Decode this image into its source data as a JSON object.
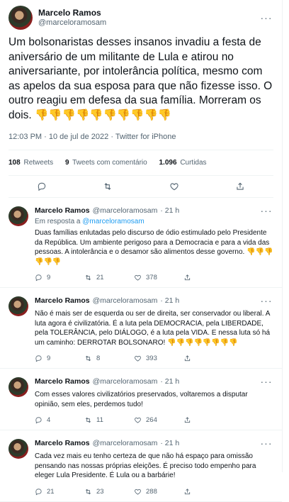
{
  "main": {
    "name": "Marcelo Ramos",
    "handle": "@marceloramosam",
    "text": "Um bolsonaristas desses insanos invadiu a festa de aniversário de um militante de Lula e atirou no aniversariante, por intolerância política, mesmo com as apelos da sua esposa para que não fizesse isso. O outro reagiu em defesa da sua família. Morreram os dois.",
    "emojis": "👎👎👎👎👎👎👎👎👎👎",
    "time": "12:03 PM",
    "date": "10 de jul de 2022",
    "source": "Twitter for iPhone",
    "stats": [
      {
        "count": "108",
        "label": "Retweets"
      },
      {
        "count": "9",
        "label": "Tweets com comentário"
      },
      {
        "count": "1.096",
        "label": "Curtidas"
      }
    ]
  },
  "replies": [
    {
      "name": "Marcelo Ramos",
      "handle": "@marceloramosam",
      "age": "· 21 h",
      "in_reply_prefix": "Em resposta a",
      "in_reply_handle": "@marceloramosam",
      "text": "Duas famílias enlutadas pelo discurso de ódio estimulado pelo Presidente da República. Um ambiente perigoso para a Democracia e para a vida das pessoas. A intolerância e o desamor são alimentos desse governo.",
      "emojis": "👎👎👎👎👎👎",
      "replies": "9",
      "retweets": "21",
      "likes": "378"
    },
    {
      "name": "Marcelo Ramos",
      "handle": "@marceloramosam",
      "age": "· 21 h",
      "text": "Não é mais ser de esquerda ou ser de direita, ser conservador ou liberal. A luta agora é civilizatória. É a luta pela DEMOCRACIA, pela LIBERDADE, pela TOLERÂNCIA, pelo DIÁLOGO, é a luta pela VIDA. E nessa luta só há um caminho: DERROTAR BOLSONARO!",
      "emojis": "👎👎👎👎👎👎👎👎",
      "replies": "9",
      "retweets": "8",
      "likes": "393"
    },
    {
      "name": "Marcelo Ramos",
      "handle": "@marceloramosam",
      "age": "· 21 h",
      "text": "Com esses valores civilizatórios preservados, voltaremos a disputar opinião, sem eles, perdemos tudo!",
      "emojis": "",
      "replies": "4",
      "retweets": "11",
      "likes": "264"
    },
    {
      "name": "Marcelo Ramos",
      "handle": "@marceloramosam",
      "age": "· 21 h",
      "text": "Cada vez mais eu tenho certeza de que não há espaço para omissão pensando nas nossas próprias eleições. É preciso todo empenho para eleger Lula Presidente. É Lula ou a barbárie!",
      "emojis": "",
      "replies": "21",
      "retweets": "23",
      "likes": "288"
    }
  ],
  "icons": {
    "more": "more-dots-icon",
    "reply": "reply-icon",
    "retweet": "retweet-icon",
    "like": "heart-icon",
    "share": "share-icon"
  },
  "colors": {
    "link": "#1d9bf0",
    "secondary": "#536471",
    "emoji": "#f5c518"
  }
}
